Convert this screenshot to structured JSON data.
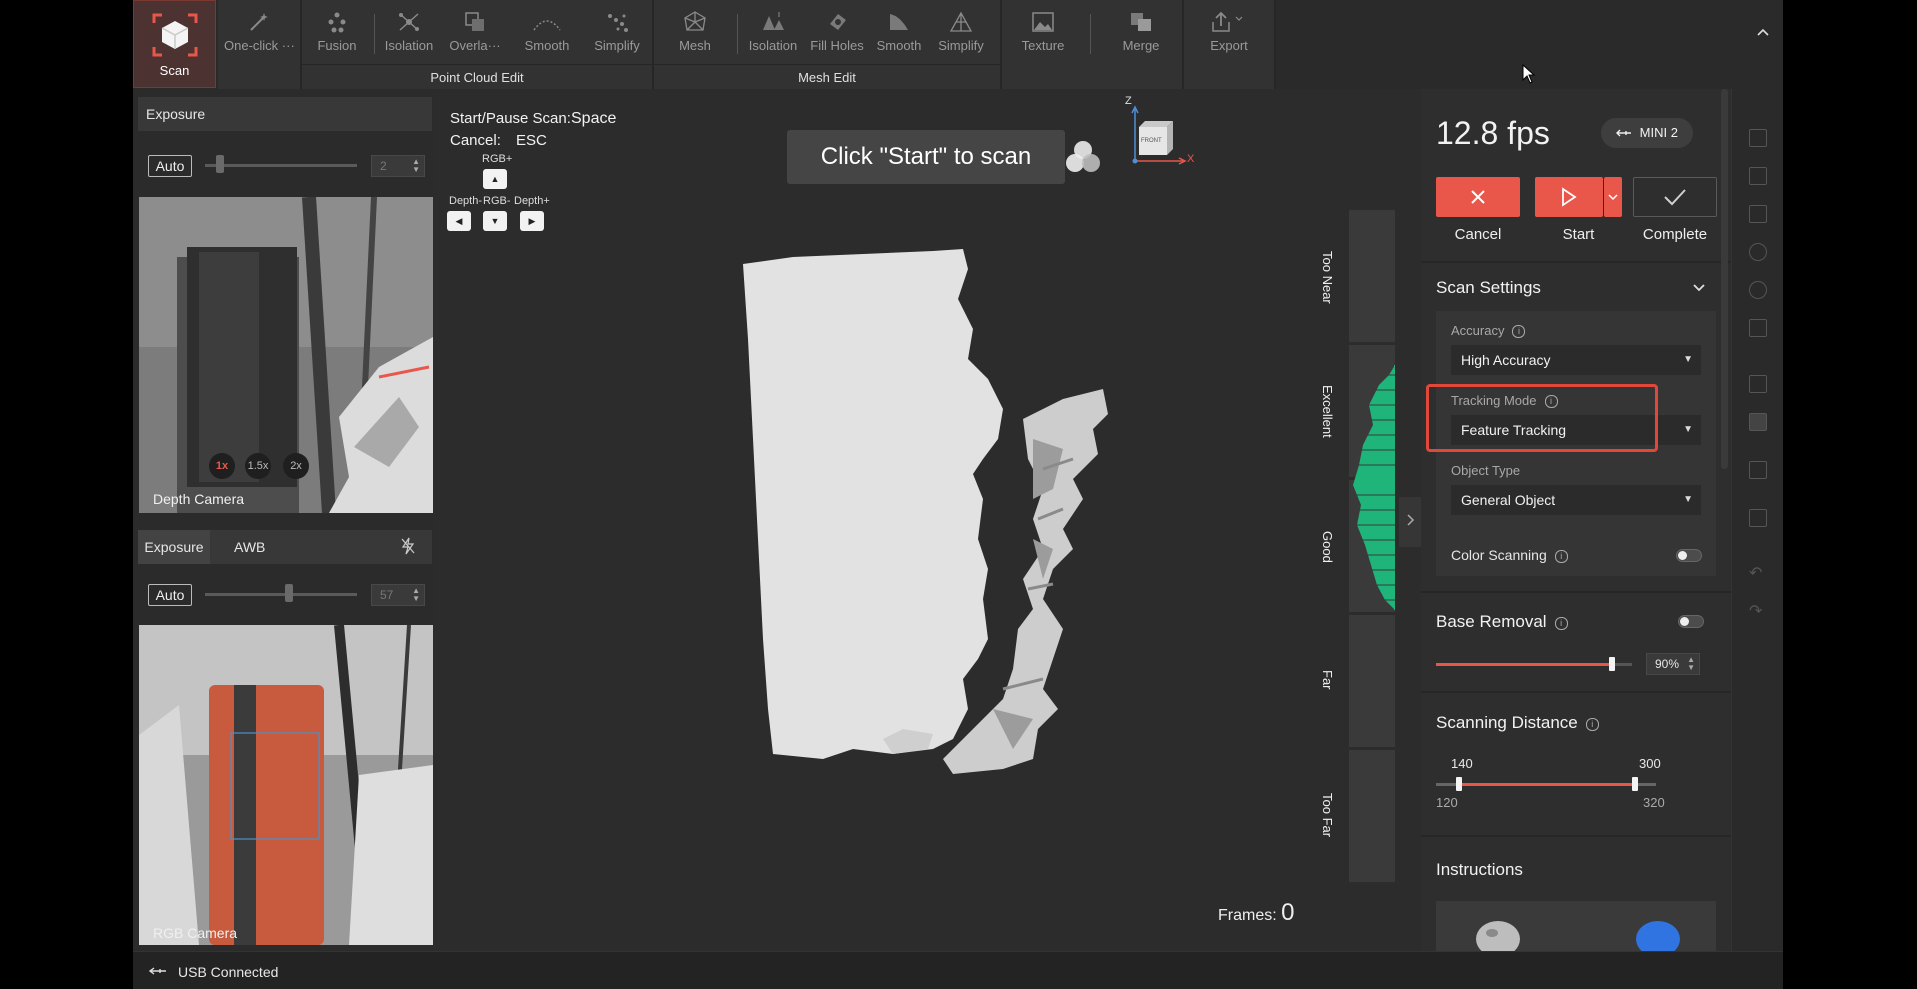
{
  "toolbar": {
    "scan_label": "Scan",
    "one_click_label": "One-click ···",
    "point_cloud": {
      "group_label": "Point Cloud Edit",
      "items": [
        "Fusion",
        "Isolation",
        "Overla···",
        "Smooth",
        "Simplify"
      ]
    },
    "mesh": {
      "group_label": "Mesh Edit",
      "items": [
        "Mesh",
        "Isolation",
        "Fill Holes",
        "Smooth",
        "Simplify"
      ]
    },
    "texture_label": "Texture",
    "merge_label": "Merge",
    "export_label": "Export"
  },
  "left_panel": {
    "depth": {
      "tab_label": "Exposure",
      "auto_label": "Auto",
      "exposure_value": "2",
      "exposure_fraction": 0.1,
      "camera_label": "Depth Camera",
      "zoom_options": [
        "1x",
        "1.5x",
        "2x"
      ]
    },
    "rgb": {
      "tabs": [
        "Exposure",
        "AWB"
      ],
      "auto_label": "Auto",
      "exposure_value": "57",
      "exposure_fraction": 0.55,
      "camera_label": "RGB Camera"
    }
  },
  "viewport": {
    "hotkeys": {
      "start_pause_label": "Start/Pause Scan:",
      "start_pause_key": "Space",
      "cancel_label": "Cancel:",
      "cancel_key": "ESC",
      "rgb_plus": "RGB+",
      "depth_minus": "Depth-",
      "rgb_minus": "RGB-",
      "depth_plus": "Depth+"
    },
    "toast": "Click \"Start\" to scan",
    "axes": {
      "z": "Z",
      "x": "X",
      "view": "FRONT"
    },
    "distance_labels": [
      "Too Near",
      "Excellent",
      "Good",
      "Far",
      "Too Far"
    ],
    "frames_label": "Frames:",
    "frames_value": "0"
  },
  "right_panel": {
    "fps": "12.8 fps",
    "device": "MINI 2",
    "actions": {
      "cancel": "Cancel",
      "start": "Start",
      "complete": "Complete"
    },
    "scan_settings": {
      "title": "Scan Settings",
      "accuracy_label": "Accuracy",
      "accuracy_value": "High Accuracy",
      "tracking_label": "Tracking Mode",
      "tracking_value": "Feature Tracking",
      "object_label": "Object Type",
      "object_value": "General Object",
      "color_scanning_label": "Color Scanning",
      "color_scanning_on": false
    },
    "base_removal": {
      "title": "Base Removal",
      "enabled": false,
      "value": "90%",
      "fraction": 0.9
    },
    "scanning_distance": {
      "title": "Scanning Distance",
      "low": "140",
      "high": "300",
      "min": "120",
      "max": "320"
    },
    "instructions_title": "Instructions"
  },
  "status": {
    "connection": "USB Connected"
  },
  "colors": {
    "accent": "#e8574a",
    "quality_green": "#1fb57a",
    "highlight": "#e2483a"
  }
}
